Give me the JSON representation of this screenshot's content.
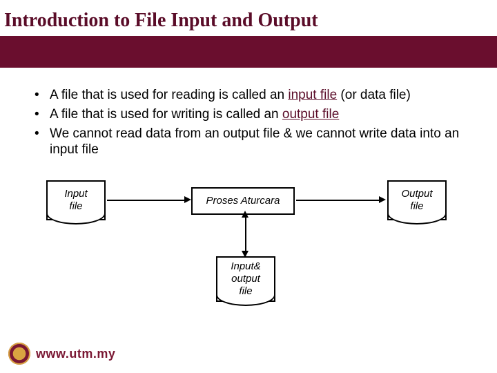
{
  "title": "Introduction to File Input and Output",
  "bullets": {
    "b1_pre": "A file that is used for reading is called an ",
    "b1_kw": "input file",
    "b1_post": " (or data file)",
    "b2_pre": "A file that is used for writing is called an ",
    "b2_kw": "output file",
    "b3": "We cannot read data from an output file & we cannot write data into an input file"
  },
  "diagram": {
    "input_label_l1": "Input",
    "input_label_l2": "file",
    "center_label": "Proses Aturcara",
    "output_label_l1": "Output",
    "output_label_l2": "file",
    "io_label_l1": "Input&",
    "io_label_l2": "output",
    "io_label_l3": "file"
  },
  "footer": {
    "url": "www.utm.my"
  }
}
